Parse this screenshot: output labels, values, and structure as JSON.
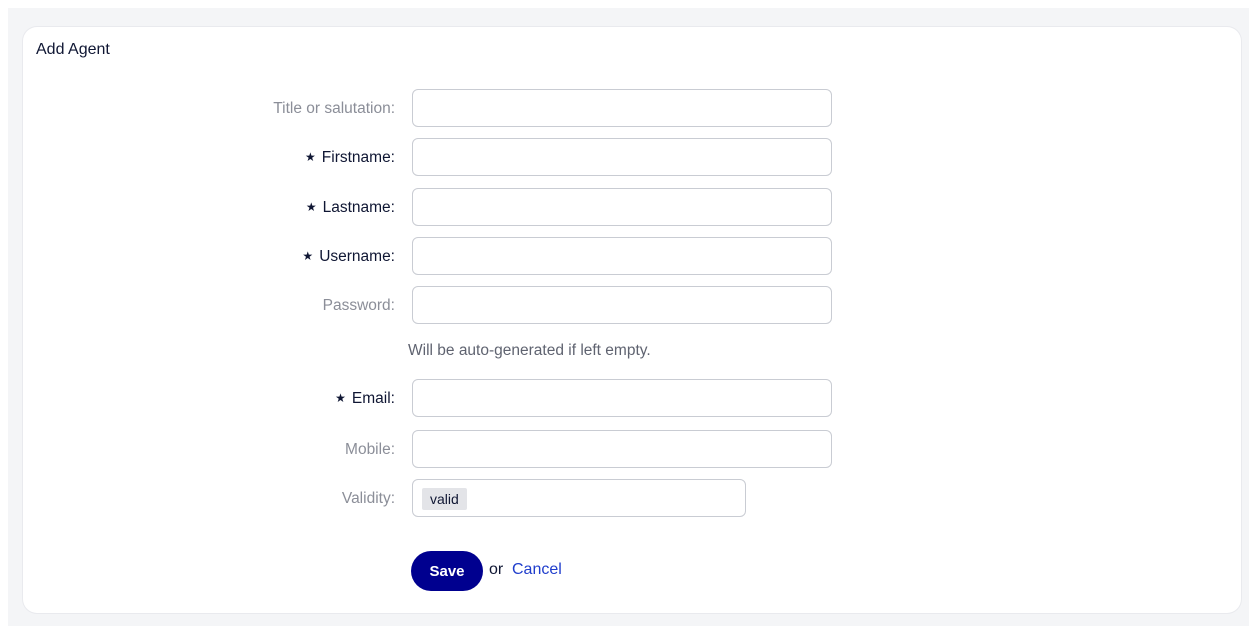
{
  "card": {
    "title": "Add Agent"
  },
  "form": {
    "fields": [
      {
        "label": "Title or salutation:",
        "required": false,
        "value": ""
      },
      {
        "label": "Firstname:",
        "required": true,
        "value": ""
      },
      {
        "label": "Lastname:",
        "required": true,
        "value": ""
      },
      {
        "label": "Username:",
        "required": true,
        "value": ""
      },
      {
        "label": "Password:",
        "required": false,
        "value": ""
      },
      {
        "label": "Email:",
        "required": true,
        "value": ""
      },
      {
        "label": "Mobile:",
        "required": false,
        "value": ""
      },
      {
        "label": "Validity:",
        "required": false,
        "value": "valid"
      }
    ],
    "password_hint": "Will be auto-generated if left empty.",
    "required_marker": "★"
  },
  "actions": {
    "save_label": "Save",
    "or_text": "or",
    "cancel_label": "Cancel"
  },
  "colors": {
    "primary_button": "#00008f",
    "link": "#1f3dcc",
    "required_label": "#0f1633",
    "optional_label": "#8b8e98"
  }
}
